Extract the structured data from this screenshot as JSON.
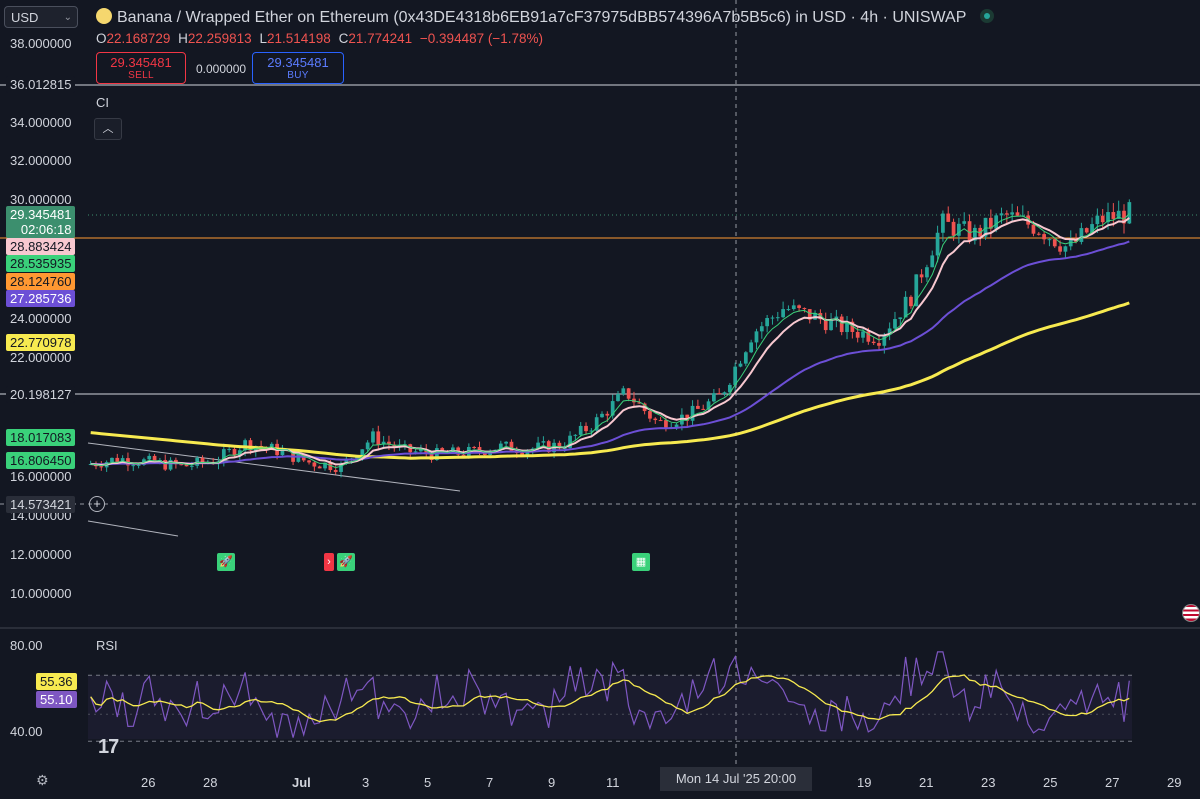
{
  "header": {
    "currency_select": "USD",
    "title": "Banana / Wrapped Ether on Ethereum (0x43DE4318b6EB91a7cF37975dBB574396A7b5B5c6) in USD · 4h · UNISWAP",
    "ohlc": {
      "o_label": "O",
      "o_value": "22.168729",
      "h_label": "H",
      "h_value": "22.259813",
      "l_label": "L",
      "l_value": "21.514198",
      "c_label": "C",
      "c_value": "21.774241",
      "change": "−0.394487 (−1.78%)"
    },
    "sell": {
      "price": "29.345481",
      "label": "SELL"
    },
    "spread": "0.000000",
    "buy": {
      "price": "29.345481",
      "label": "BUY"
    }
  },
  "indicator_labels": {
    "ci": "CI",
    "rsi": "RSI"
  },
  "y_axis": [
    "38.000000",
    "34.000000",
    "32.000000",
    "30.000000",
    "24.000000",
    "22.000000",
    "16.000000",
    "14.000000",
    "12.000000",
    "10.000000"
  ],
  "price_tags": [
    {
      "value": "36.012815",
      "bg": "#131722",
      "fg": "#d1d4dc",
      "border": "#d1d4dc"
    },
    {
      "value": "29.345481",
      "bg": "#3c8f6e",
      "fg": "#ffffff",
      "sub": "02:06:18"
    },
    {
      "value": "28.883424",
      "bg": "#f8c8d0",
      "fg": "#131722"
    },
    {
      "value": "28.535935",
      "bg": "#3ad17a",
      "fg": "#131722"
    },
    {
      "value": "28.124760",
      "bg": "#ff9832",
      "fg": "#131722"
    },
    {
      "value": "27.285736",
      "bg": "#6c4fd6",
      "fg": "#ffffff"
    },
    {
      "value": "22.770978",
      "bg": "#f7ea50",
      "fg": "#131722"
    },
    {
      "value": "20.198127",
      "bg": "#131722",
      "fg": "#d1d4dc",
      "border": "#d1d4dc"
    },
    {
      "value": "18.017083",
      "bg": "#3ad17a",
      "fg": "#131722"
    },
    {
      "value": "16.806450",
      "bg": "#3ad17a",
      "fg": "#131722"
    },
    {
      "value": "14.573421",
      "bg": "#2a2e39",
      "fg": "#d1d4dc"
    }
  ],
  "rsi_axis": [
    "80.00",
    "40.00"
  ],
  "rsi_tags": [
    {
      "value": "55.36",
      "bg": "#f7ea50",
      "fg": "#131722"
    },
    {
      "value": "55.10",
      "bg": "#7e57c2",
      "fg": "#ffffff"
    }
  ],
  "x_axis": [
    "26",
    "28",
    "Jul",
    "3",
    "5",
    "7",
    "9",
    "11",
    "19",
    "21",
    "23",
    "25",
    "27",
    "29"
  ],
  "crosshair_date": "Mon 14 Jul '25   20:00",
  "colors": {
    "up": "#26a69a",
    "down": "#ef5350",
    "bg": "#131722",
    "ema_yellow": "#f7ea50",
    "ema_purple": "#6c4fd6",
    "ema_pink": "#f8c8d0",
    "ema_green": "#3ad17a",
    "rsi": "#7e57c2"
  },
  "icons": [
    "settings-icon",
    "collapse-icon",
    "flag-icon",
    "rocket-icon",
    "checkered-flag-icon",
    "add-icon"
  ],
  "chart_data": {
    "type": "candlestick",
    "interval": "4h",
    "ylim": [
      9,
      39
    ],
    "grid": false,
    "price_path": [
      [
        "2025-06-24",
        16.5
      ],
      [
        "2025-06-25",
        16.8
      ],
      [
        "2025-06-26",
        16.6
      ],
      [
        "2025-06-27",
        16.4
      ],
      [
        "2025-06-28",
        16.7
      ],
      [
        "2025-06-29",
        17.6
      ],
      [
        "2025-06-30",
        17.2
      ],
      [
        "2025-07-01",
        16.6
      ],
      [
        "2025-07-02",
        16.4
      ],
      [
        "2025-07-03",
        17.9
      ],
      [
        "2025-07-04",
        17.2
      ],
      [
        "2025-07-05",
        17.0
      ],
      [
        "2025-07-06",
        17.1
      ],
      [
        "2025-07-07",
        17.4
      ],
      [
        "2025-07-08",
        17.3
      ],
      [
        "2025-07-09",
        17.5
      ],
      [
        "2025-07-10",
        18.6
      ],
      [
        "2025-07-11",
        20.2
      ],
      [
        "2025-07-12",
        18.6
      ],
      [
        "2025-07-13",
        19.0
      ],
      [
        "2025-07-14",
        20.0
      ],
      [
        "2025-07-15",
        23.2
      ],
      [
        "2025-07-16",
        24.5
      ],
      [
        "2025-07-17",
        24.0
      ],
      [
        "2025-07-18",
        23.4
      ],
      [
        "2025-07-19",
        23.0
      ],
      [
        "2025-07-20",
        25.0
      ],
      [
        "2025-07-21",
        28.8
      ],
      [
        "2025-07-22",
        28.2
      ],
      [
        "2025-07-23",
        29.2
      ],
      [
        "2025-07-24",
        28.6
      ],
      [
        "2025-07-25",
        27.5
      ],
      [
        "2025-07-26",
        29.0
      ],
      [
        "2025-07-27",
        29.35
      ]
    ],
    "rsi_ylim": [
      30,
      85
    ],
    "rsi_levels": [
      70,
      50
    ]
  }
}
